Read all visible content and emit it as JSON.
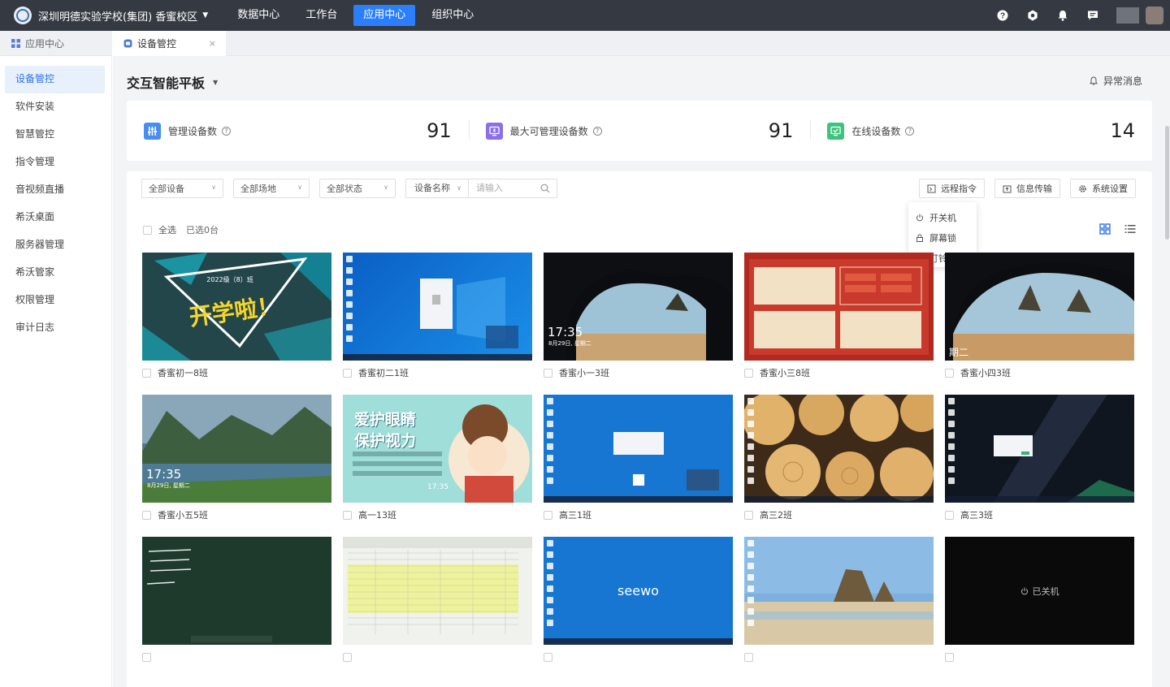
{
  "topbar": {
    "school": "深圳明德实验学校(集团) 香蜜校区",
    "nav": [
      "数据中心",
      "工作台",
      "应用中心",
      "组织中心"
    ],
    "active_nav": "应用中心",
    "icons": [
      "help-icon",
      "settings-icon",
      "bell-icon",
      "message-icon"
    ]
  },
  "tabs": {
    "app_center": "应用中心",
    "device_control": "设备管控"
  },
  "sidebar": {
    "items": [
      "设备管控",
      "软件安装",
      "智慧管控",
      "指令管理",
      "音视频直播",
      "希沃桌面",
      "服务器管理",
      "希沃管家",
      "权限管理",
      "审计日志"
    ],
    "active": "设备管控"
  },
  "header": {
    "title": "交互智能平板",
    "alert_link": "异常消息"
  },
  "stats": [
    {
      "label": "管理设备数",
      "value": "91",
      "color": "#4a8df0",
      "icon": "sliders-icon"
    },
    {
      "label": "最大可管理设备数",
      "value": "91",
      "color": "#8b6fe8",
      "icon": "monitor-icon"
    },
    {
      "label": "在线设备数",
      "value": "14",
      "color": "#3cc47c",
      "icon": "checked-screen-icon"
    }
  ],
  "filters": {
    "all_devices": "全部设备",
    "all_venues": "全部场地",
    "all_status": "全部状态",
    "search_field": "设备名称",
    "search_placeholder": "请输入"
  },
  "actions": {
    "remote_command": "远程指令",
    "info_transfer": "信息传输",
    "system_settings": "系统设置"
  },
  "dropdown": {
    "items": [
      "开关机",
      "屏幕锁",
      "打铃"
    ]
  },
  "selection": {
    "select_all": "全选",
    "selected_count": "已选0台"
  },
  "devices": [
    {
      "name": "香蜜初一8班",
      "screen": "chalk"
    },
    {
      "name": "香蜜初二1班",
      "screen": "win10"
    },
    {
      "name": "香蜜小一3班",
      "screen": "cave",
      "clock": "17:35",
      "date": "8月29日, 星期二"
    },
    {
      "name": "香蜜小三8班",
      "screen": "red"
    },
    {
      "name": "香蜜小四3班",
      "screen": "cave2",
      "clock": "期二"
    },
    {
      "name": "香蜜小五5班",
      "screen": "lake",
      "clock": "17:35",
      "date": "8月29日, 星期二"
    },
    {
      "name": "高一13班",
      "screen": "eyes",
      "headline1": "爱护眼睛",
      "headline2": "保护视力",
      "clock": "17:35"
    },
    {
      "name": "高三1班",
      "screen": "bluedesk"
    },
    {
      "name": "高三2班",
      "screen": "logs"
    },
    {
      "name": "高三3班",
      "screen": "milky"
    },
    {
      "name": "",
      "screen": "chalk2"
    },
    {
      "name": "",
      "screen": "excel"
    },
    {
      "name": "",
      "screen": "seewo",
      "brand": "seewo"
    },
    {
      "name": "",
      "screen": "beach"
    },
    {
      "name": "",
      "screen": "off",
      "status": "已关机"
    }
  ],
  "chalk_text": {
    "line1": "2022级（8）班",
    "line2": "开学啦！"
  }
}
